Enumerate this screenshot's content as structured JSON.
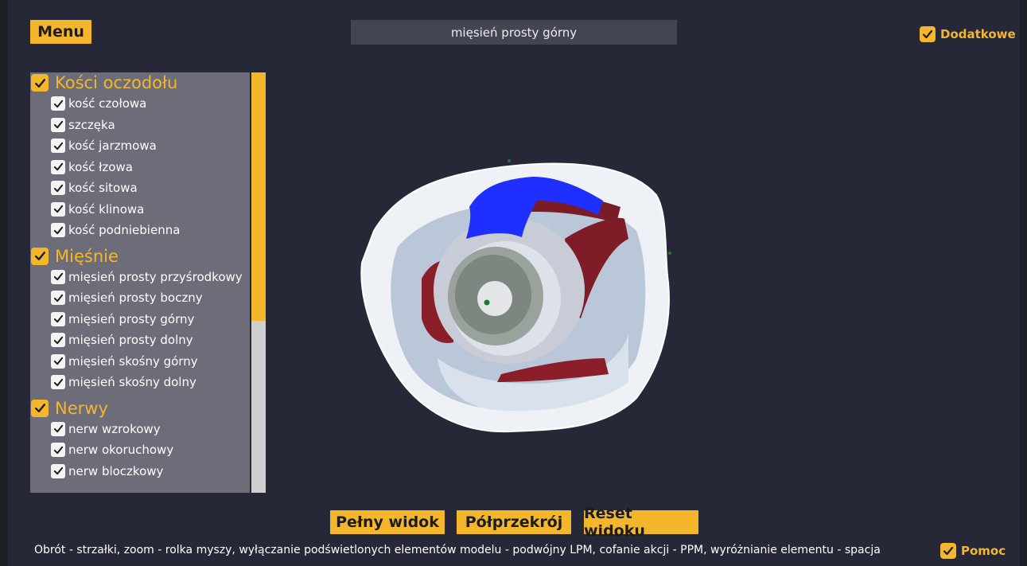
{
  "header": {
    "menu_label": "Menu",
    "search_value": "mięsień prosty górny",
    "extra_toggle_label": "Dodatkowe"
  },
  "sidebar": {
    "categories": [
      {
        "label": "Kości oczodołu",
        "items": [
          "kość czołowa",
          "szczęka",
          "kość jarzmowa",
          "kość łzowa",
          "kość sitowa",
          "kość klinowa",
          "kość podniebienna"
        ]
      },
      {
        "label": "Mięśnie",
        "items": [
          "mięsień prosty przyśrodkowy",
          "mięsień prosty boczny",
          "mięsień prosty górny",
          "mięsień prosty dolny",
          "mięsień skośny górny",
          "mięsień skośny dolny"
        ]
      },
      {
        "label": "Nerwy",
        "items": [
          "nerw wzrokowy",
          "nerw okoruchowy",
          "nerw bloczkowy"
        ]
      }
    ]
  },
  "view_buttons": {
    "full": "Pełny widok",
    "half": "Półprzekrój",
    "reset": "Reset widoku"
  },
  "footer": {
    "help_text": "Obrót - strzałki, zoom - rolka myszy, wyłączanie podświetlonych elementów modelu - podwójny LPM, cofanie akcji -  PPM, wyróżnianie elementu - spacja",
    "help_toggle_label": "Pomoc"
  },
  "colors": {
    "accent": "#f4b62a",
    "background": "#262838",
    "panel": "#6c6d78",
    "highlight_muscle": "#1f2fff"
  }
}
